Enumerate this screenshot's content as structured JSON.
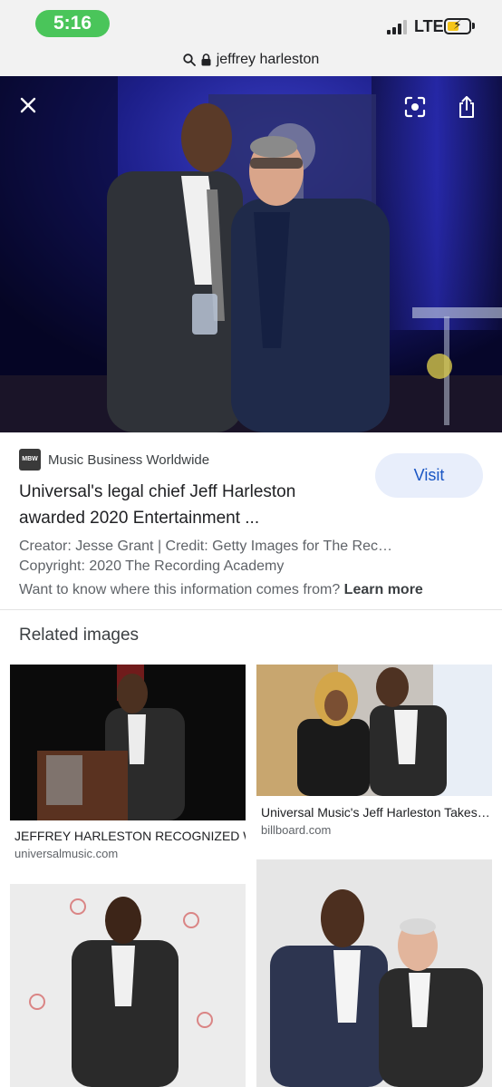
{
  "status_bar": {
    "time": "5:16",
    "network": "LTE"
  },
  "url_bar": {
    "query": "jeffrey harleston"
  },
  "hero": {
    "close_icon": "close-icon",
    "lens_icon": "lens-icon",
    "share_icon": "share-icon"
  },
  "result": {
    "source_logo": "MBW",
    "source": "Music Business Worldwide",
    "visit_label": "Visit",
    "title": "Universal's legal chief Jeff Harleston awarded 2020 Entertainment ...",
    "creator": "Creator: Jesse Grant | Credit: Getty Images for The Rec…",
    "copyright": "Copyright: 2020 The Recording Academy",
    "info_question": "Want to know where this information comes from?",
    "learn_more": "Learn more"
  },
  "related": {
    "heading": "Related images",
    "items": [
      {
        "title": "JEFFREY HARLESTON RECOGNIZED W…",
        "source": "universalmusic.com"
      },
      {
        "title": "Universal Music's Jeff Harleston Takes…",
        "source": "billboard.com"
      }
    ]
  },
  "colors": {
    "accent": "#1a56c4",
    "visit_bg": "#e8eefb",
    "time_pill": "#4ac55a"
  }
}
